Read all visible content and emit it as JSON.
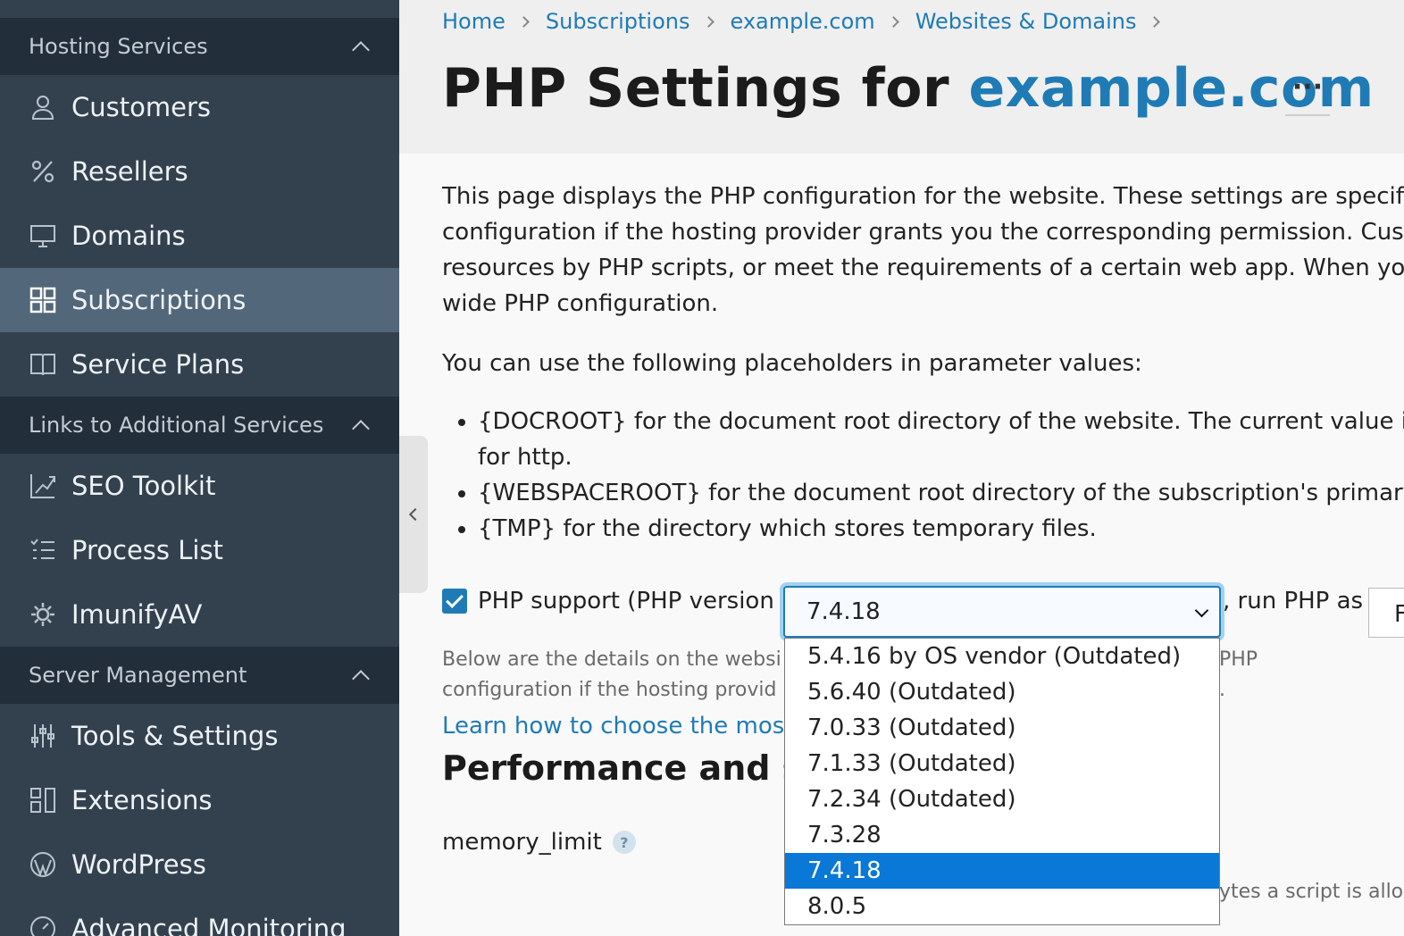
{
  "sidebar": {
    "sections": [
      {
        "title": "Hosting Services"
      },
      {
        "title": "Links to Additional Services"
      },
      {
        "title": "Server Management"
      }
    ],
    "hosting_items": [
      {
        "label": "Customers",
        "icon": "user-icon"
      },
      {
        "label": "Resellers",
        "icon": "percent-icon"
      },
      {
        "label": "Domains",
        "icon": "monitor-icon"
      },
      {
        "label": "Subscriptions",
        "icon": "grid-icon",
        "active": true
      },
      {
        "label": "Service Plans",
        "icon": "book-icon"
      }
    ],
    "links_items": [
      {
        "label": "SEO Toolkit",
        "icon": "chart-icon"
      },
      {
        "label": "Process List",
        "icon": "list-icon"
      },
      {
        "label": "ImunifyAV",
        "icon": "gear-icon"
      }
    ],
    "server_items": [
      {
        "label": "Tools & Settings",
        "icon": "sliders-icon"
      },
      {
        "label": "Extensions",
        "icon": "extensions-icon"
      },
      {
        "label": "WordPress",
        "icon": "wordpress-icon"
      },
      {
        "label": "Advanced Monitoring",
        "icon": "monitoring-icon"
      }
    ]
  },
  "breadcrumb": [
    "Home",
    "Subscriptions",
    "example.com",
    "Websites & Domains"
  ],
  "title": {
    "prefix": "PHP Settings for ",
    "domain": "example.com",
    "more": "···"
  },
  "content": {
    "desc_lines": [
      "This page displays the PHP configuration for the website. These settings are specifi",
      "configuration if the hosting provider grants you the corresponding permission. Cus",
      "resources by PHP scripts, or meet the requirements of a certain web app. When yo",
      "wide PHP configuration."
    ],
    "placeholders_intro": "You can use the following placeholders in parameter values:",
    "bullets": [
      "{DOCROOT} for the document root directory of the website. The current value is",
      "for http.",
      "{WEBSPACEROOT} for the document root directory of the subscription's primary",
      "{TMP} for the directory which stores temporary files."
    ],
    "php_support_label": "PHP support (PHP version",
    "run_as_label": ", run PHP as",
    "run_as_value": "F",
    "below_lines": [
      "Below are the details on the websi",
      "configuration if the hosting provid"
    ],
    "php_hint_lines": [
      "PHP",
      "."
    ],
    "learn_link": "Learn how to choose the mos",
    "perf_heading": "Performance and se",
    "memory_limit": "memory_limit",
    "help": "?",
    "bytes_text": "ytes a script is allow"
  },
  "php_select": {
    "selected": "7.4.18",
    "options": [
      "5.4.16 by OS vendor (Outdated)",
      "5.6.40 (Outdated)",
      "7.0.33 (Outdated)",
      "7.1.33 (Outdated)",
      "7.2.34 (Outdated)",
      "7.3.28",
      "7.4.18",
      "8.0.5"
    ]
  }
}
